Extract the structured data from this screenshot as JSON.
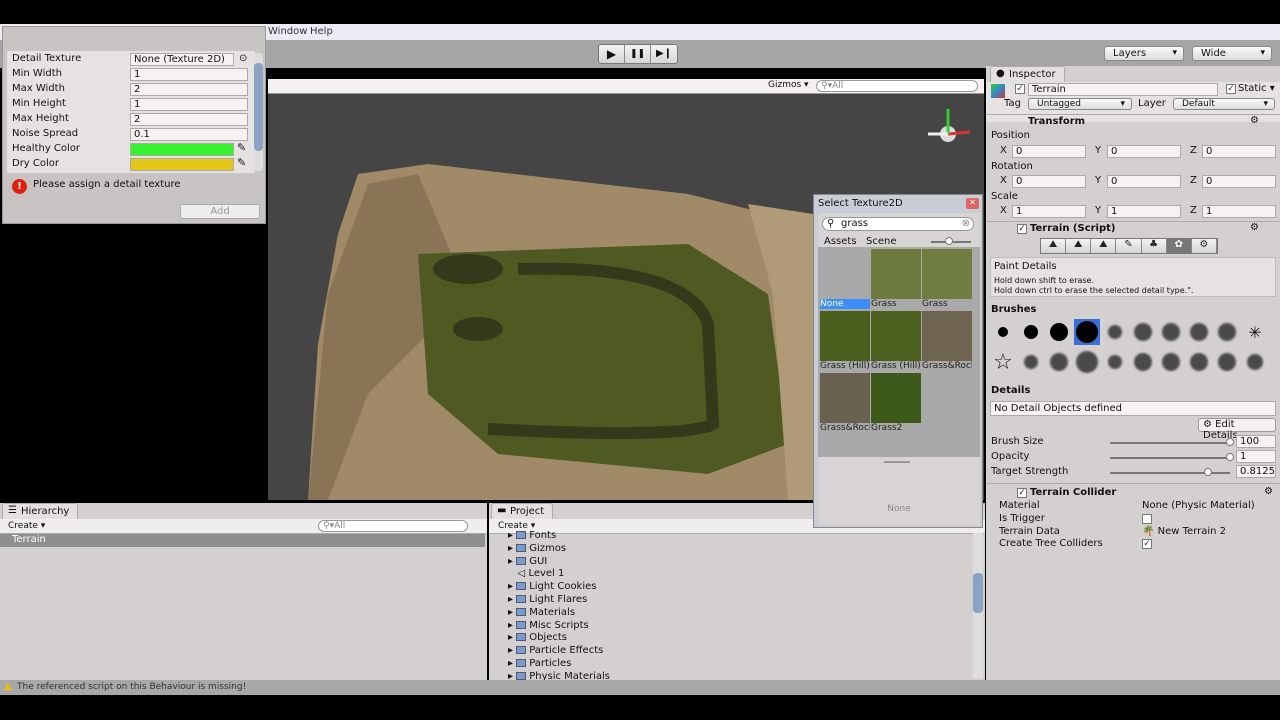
{
  "menu": {
    "window": "Window",
    "help": "Help"
  },
  "toolbar": {
    "play": "▶",
    "pause": "❚❚",
    "step": "▶❙",
    "layers": "Layers",
    "layout": "Wide"
  },
  "scene": {
    "gizmos": "Gizmos",
    "search_placeholder": "All"
  },
  "detail_dialog": {
    "rows": [
      {
        "label": "Detail Texture",
        "value": "None (Texture 2D)"
      },
      {
        "label": "Min Width",
        "value": "1"
      },
      {
        "label": "Max Width",
        "value": "2"
      },
      {
        "label": "Min Height",
        "value": "1"
      },
      {
        "label": "Max Height",
        "value": "2"
      },
      {
        "label": "Noise Spread",
        "value": "0.1"
      }
    ],
    "healthy_label": "Healthy Color",
    "healthy_color": "#35f22c",
    "dry_label": "Dry Color",
    "dry_color": "#e3c81a",
    "error": "Please assign a detail texture",
    "add": "Add"
  },
  "select_texture": {
    "title": "Select Texture2D",
    "search": "grass",
    "tabs": [
      "Assets",
      "Scene"
    ],
    "items": [
      {
        "name": "None",
        "selected": true
      },
      {
        "name": "Grass"
      },
      {
        "name": "Grass"
      },
      {
        "name": "Grass (Hill)"
      },
      {
        "name": "Grass (Hill)"
      },
      {
        "name": "Grass&Rock"
      },
      {
        "name": "Grass&Rock"
      },
      {
        "name": "Grass2"
      }
    ],
    "preview_label": "None"
  },
  "inspector": {
    "tab": "Inspector",
    "object_name": "Terrain",
    "static": "Static",
    "tag_label": "Tag",
    "tag": "Untagged",
    "layer_label": "Layer",
    "layer": "Default",
    "transform": {
      "title": "Transform",
      "position": "Position",
      "rotation": "Rotation",
      "scale": "Scale",
      "pos": [
        "0",
        "0",
        "0"
      ],
      "rot": [
        "0",
        "0",
        "0"
      ],
      "scl": [
        "1",
        "1",
        "1"
      ],
      "axes": [
        "X",
        "Y",
        "Z"
      ]
    },
    "terrain": {
      "title": "Terrain (Script)",
      "tool_title": "Paint Details",
      "help1": "Hold down shift to erase.",
      "help2": "Hold down ctrl to erase the selected detail type.\".",
      "brushes": "Brushes",
      "details": "Details",
      "no_details": "No Detail Objects defined",
      "edit_details": "Edit Details...",
      "brush_size_label": "Brush Size",
      "brush_size": "100",
      "opacity_label": "Opacity",
      "opacity": "1",
      "target_label": "Target Strength",
      "target": "0.8125"
    },
    "collider": {
      "title": "Terrain Collider",
      "material_label": "Material",
      "material": "None (Physic Material)",
      "trigger_label": "Is Trigger",
      "data_label": "Terrain Data",
      "data": "New Terrain 2",
      "trees_label": "Create Tree Colliders"
    }
  },
  "hierarchy": {
    "tab": "Hierarchy",
    "create": "Create",
    "search_placeholder": "All",
    "items": [
      "Terrain"
    ]
  },
  "project": {
    "tab": "Project",
    "create": "Create",
    "items": [
      "Fonts",
      "Gizmos",
      "GUI",
      "Level 1",
      "Light Cookies",
      "Light Flares",
      "Materials",
      "Misc Scripts",
      "Objects",
      "Particle Effects",
      "Particles",
      "Physic Materials"
    ]
  },
  "status": {
    "message": "The referenced script on this Behaviour is missing!"
  }
}
